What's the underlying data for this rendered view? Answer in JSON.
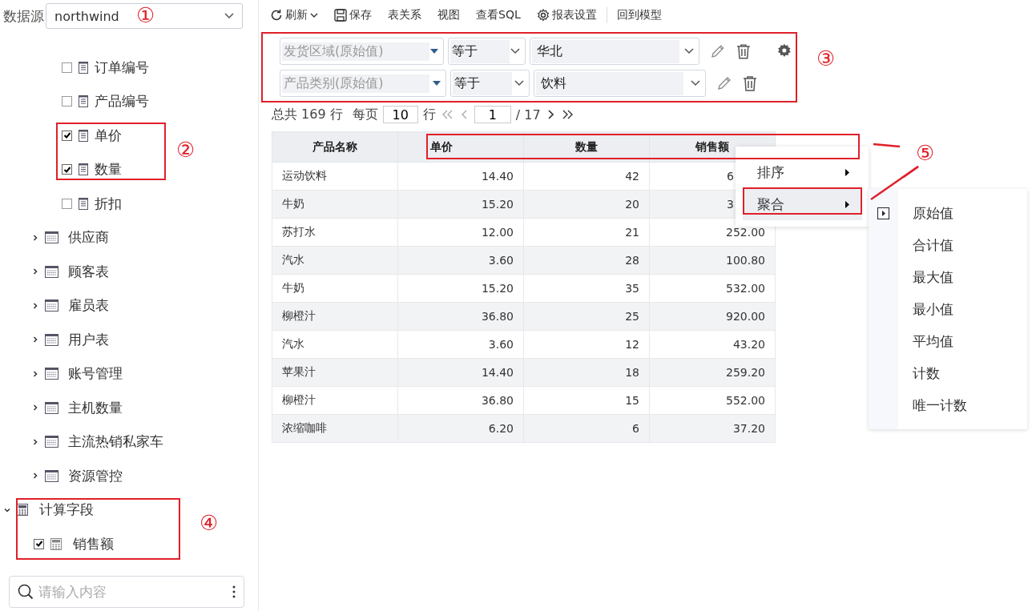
{
  "datasource": {
    "label": "数据源",
    "value": "northwind"
  },
  "tree": {
    "fields": [
      {
        "label": "订单编号",
        "checked": false
      },
      {
        "label": "产品编号",
        "checked": false
      },
      {
        "label": "单价",
        "checked": true
      },
      {
        "label": "数量",
        "checked": true
      },
      {
        "label": "折扣",
        "checked": false
      }
    ],
    "tables": [
      {
        "label": "供应商",
        "expanded": false
      },
      {
        "label": "顾客表",
        "expanded": false
      },
      {
        "label": "雇员表",
        "expanded": false
      },
      {
        "label": "用户表",
        "expanded": false
      },
      {
        "label": "账号管理",
        "expanded": false
      },
      {
        "label": "主机数量",
        "expanded": false
      },
      {
        "label": "主流热销私家车",
        "expanded": false
      },
      {
        "label": "资源管控",
        "expanded": false
      }
    ],
    "calc_group": {
      "label": "计算字段",
      "expanded": true,
      "children": [
        {
          "label": "销售额",
          "checked": true
        }
      ]
    }
  },
  "search": {
    "placeholder": "请输入内容"
  },
  "toolbar": [
    {
      "label": "刷新",
      "kind": "refresh"
    },
    {
      "label": "保存",
      "kind": "save"
    },
    {
      "label": "表关系",
      "kind": "plain"
    },
    {
      "label": "视图",
      "kind": "plain"
    },
    {
      "label": "查看SQL",
      "kind": "plain"
    },
    {
      "label": "报表设置",
      "kind": "settings"
    },
    {
      "label": "回到模型",
      "kind": "separated"
    }
  ],
  "filters": [
    {
      "field": "发货区域(原始值)",
      "operator": "等于",
      "value": "华北",
      "settings": true
    },
    {
      "field": "产品类别(原始值)",
      "operator": "等于",
      "value": "饮料",
      "settings": false
    }
  ],
  "pager": {
    "total": "总共 169 行",
    "per_page_label": "每页",
    "per_page": "10",
    "rows_label": "行",
    "page": "1",
    "pages": "/ 17"
  },
  "table": {
    "columns": [
      "产品名称",
      "单价",
      "数量",
      "销售额"
    ],
    "rows": [
      {
        "cells": [
          "运动饮料",
          "14.40",
          "42",
          "6"
        ],
        "covered": true
      },
      {
        "cells": [
          "牛奶",
          "15.20",
          "20",
          "3"
        ],
        "covered": true
      },
      {
        "cells": [
          "苏打水",
          "12.00",
          "21",
          "252.00"
        ],
        "covered": false
      },
      {
        "cells": [
          "汽水",
          "3.60",
          "28",
          "100.80"
        ],
        "covered": false
      },
      {
        "cells": [
          "牛奶",
          "15.20",
          "35",
          "532.00"
        ],
        "covered": false
      },
      {
        "cells": [
          "柳橙汁",
          "36.80",
          "25",
          "920.00"
        ],
        "covered": false
      },
      {
        "cells": [
          "汽水",
          "3.60",
          "12",
          "43.20"
        ],
        "covered": false
      },
      {
        "cells": [
          "苹果汁",
          "14.40",
          "18",
          "259.20"
        ],
        "covered": false
      },
      {
        "cells": [
          "柳橙汁",
          "36.80",
          "15",
          "552.00"
        ],
        "covered": false
      },
      {
        "cells": [
          "浓缩咖啡",
          "6.20",
          "6",
          "37.20"
        ],
        "covered": false
      }
    ]
  },
  "context_menu": [
    {
      "label": "排序",
      "selected": false
    },
    {
      "label": "聚合",
      "selected": true
    }
  ],
  "submenu": [
    {
      "label": "原始值",
      "selected": true
    },
    {
      "label": "合计值",
      "selected": false
    },
    {
      "label": "最大值",
      "selected": false
    },
    {
      "label": "最小值",
      "selected": false
    },
    {
      "label": "平均值",
      "selected": false
    },
    {
      "label": "计数",
      "selected": false
    },
    {
      "label": "唯一计数",
      "selected": false
    }
  ],
  "annotations": [
    "①",
    "②",
    "③",
    "④",
    "⑤"
  ]
}
